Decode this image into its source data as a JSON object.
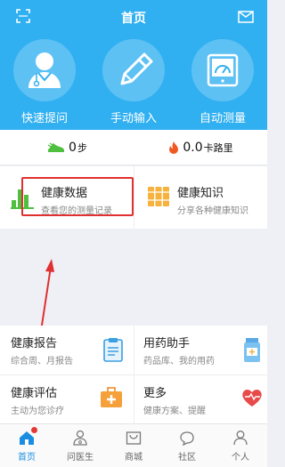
{
  "header": {
    "title": "首页",
    "scan_icon": "scan-icon",
    "mail_icon": "mail-icon"
  },
  "quick_actions": [
    {
      "label": "快速提问",
      "icon": "doctor-icon"
    },
    {
      "label": "手动输入",
      "icon": "pencil-icon"
    },
    {
      "label": "自动测量",
      "icon": "gauge-icon"
    }
  ],
  "stats": {
    "steps_value": "0",
    "steps_unit": "步",
    "calories_value": "0.0",
    "calories_unit": "卡路里"
  },
  "health": {
    "data_title": "健康数据",
    "data_sub": "查看您的测量记录",
    "knowledge_title": "健康知识",
    "knowledge_sub": "分享各种健康知识"
  },
  "grid": {
    "report_title": "健康报告",
    "report_sub": "综合周、月报告",
    "medicine_title": "用药助手",
    "medicine_sub": "药品库、我的用药",
    "assess_title": "健康评估",
    "assess_sub": "主动为您诊疗",
    "more_title": "更多",
    "more_sub": "健康方案、提醒"
  },
  "tabs": [
    {
      "label": "首页",
      "icon": "home-icon"
    },
    {
      "label": "问医生",
      "icon": "doctor-icon"
    },
    {
      "label": "商城",
      "icon": "shop-icon"
    },
    {
      "label": "社区",
      "icon": "chat-icon"
    },
    {
      "label": "个人",
      "icon": "person-icon"
    }
  ],
  "colors": {
    "header_bg": "#31b0f1",
    "accent_red": "#e03030",
    "active_tab": "#1a8de0"
  }
}
